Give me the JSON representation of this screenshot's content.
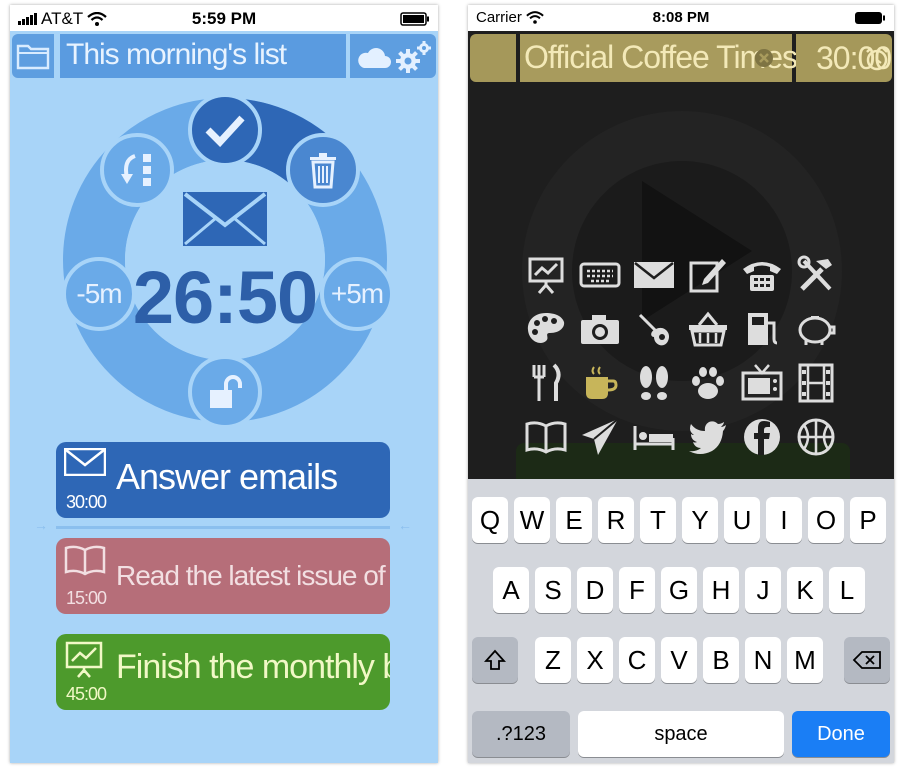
{
  "left": {
    "status": {
      "carrier": "AT&T",
      "time": "5:59 PM"
    },
    "header": {
      "list_title": "This morning's list"
    },
    "ring": {
      "timer": "26:50",
      "minus_label": "-5m",
      "plus_label": "+5m"
    },
    "tasks": [
      {
        "title": "Answer emails",
        "duration": "30:00",
        "color": "#2e67b6"
      },
      {
        "title": "Read the latest issue of Tap! Mag",
        "duration": "15:00",
        "color": "#b66e79"
      },
      {
        "title": "Finish the monthly budget",
        "duration": "45:00",
        "color": "#4d9a2c"
      }
    ]
  },
  "right": {
    "status": {
      "carrier": "Carrier",
      "time": "8:08 PM"
    },
    "header": {
      "title_value": "Official Coffee Times",
      "timer": "30:00"
    },
    "icons": [
      "presentation-icon",
      "keyboard-icon",
      "envelope-icon",
      "edit-icon",
      "phone-icon",
      "tools-icon",
      "palette-icon",
      "camera-icon",
      "guitar-icon",
      "basket-icon",
      "gas-pump-icon",
      "piggy-bank-icon",
      "fork-knife-icon",
      "coffee-cup-icon",
      "footprints-icon",
      "paw-icon",
      "tv-icon",
      "film-icon",
      "book-icon",
      "paper-plane-icon",
      "bed-icon",
      "twitter-icon",
      "facebook-icon",
      "basketball-icon"
    ],
    "keyboard": {
      "row1": [
        "Q",
        "W",
        "E",
        "R",
        "T",
        "Y",
        "U",
        "I",
        "O",
        "P"
      ],
      "row2": [
        "A",
        "S",
        "D",
        "F",
        "G",
        "H",
        "J",
        "K",
        "L"
      ],
      "row3": [
        "Z",
        "X",
        "C",
        "V",
        "B",
        "N",
        "M"
      ],
      "numbers_label": ".?123",
      "space_label": "space",
      "done_label": "Done"
    }
  }
}
